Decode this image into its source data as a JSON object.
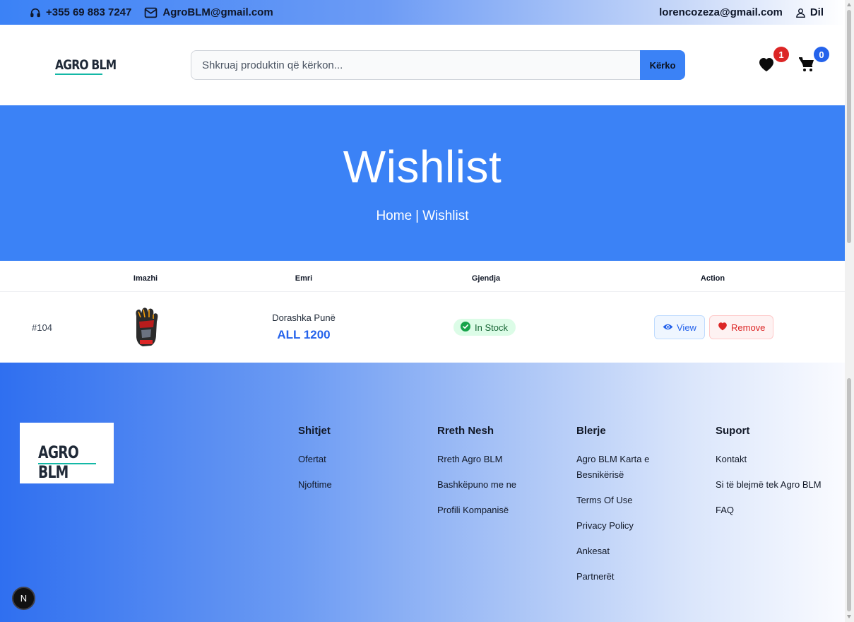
{
  "topbar": {
    "phone": "+355 69 883 7247",
    "email": "AgroBLM@gmail.com",
    "user_email": "lorencozeza@gmail.com",
    "logout_label": "Dil"
  },
  "header": {
    "logo": "AGRO BLM",
    "search_placeholder": "Shkruaj produktin që kërkon...",
    "search_button": "Kërko",
    "wishlist_count": "1",
    "cart_count": "0",
    "wishlist_badge_color": "#dc2626",
    "cart_badge_color": "#2563eb"
  },
  "hero": {
    "title": "Wishlist",
    "breadcrumb_home": "Home",
    "breadcrumb_separator": "|",
    "breadcrumb_current": "Wishlist"
  },
  "table": {
    "headers": [
      "Imazhi",
      "Emri",
      "Gjendja",
      "Action"
    ],
    "rows": [
      {
        "id": "#104",
        "name": "Dorashka Punë",
        "price": "ALL 1200",
        "status": "In Stock",
        "view_label": "View",
        "remove_label": "Remove"
      }
    ]
  },
  "footer": {
    "logo": "AGRO BLM",
    "columns": [
      {
        "title": "Shitjet",
        "links": [
          "Ofertat",
          "Njoftime"
        ]
      },
      {
        "title": "Rreth Nesh",
        "links": [
          "Rreth Agro BLM",
          "Bashkëpuno me ne",
          "Profili Kompanisë"
        ]
      },
      {
        "title": "Blerje",
        "links": [
          "Agro BLM Karta e Besnikërisë",
          "Terms Of Use",
          "Privacy Policy",
          "Ankesat",
          "Partnerët"
        ]
      },
      {
        "title": "Suport",
        "links": [
          "Kontakt",
          "Si të blejmë tek Agro BLM",
          "FAQ"
        ]
      }
    ]
  },
  "dev_badge": "N",
  "colors": {
    "primary": "#3b82f6",
    "price": "#2563eb",
    "in_stock_bg": "#dcfce7",
    "remove": "#dc2626"
  }
}
